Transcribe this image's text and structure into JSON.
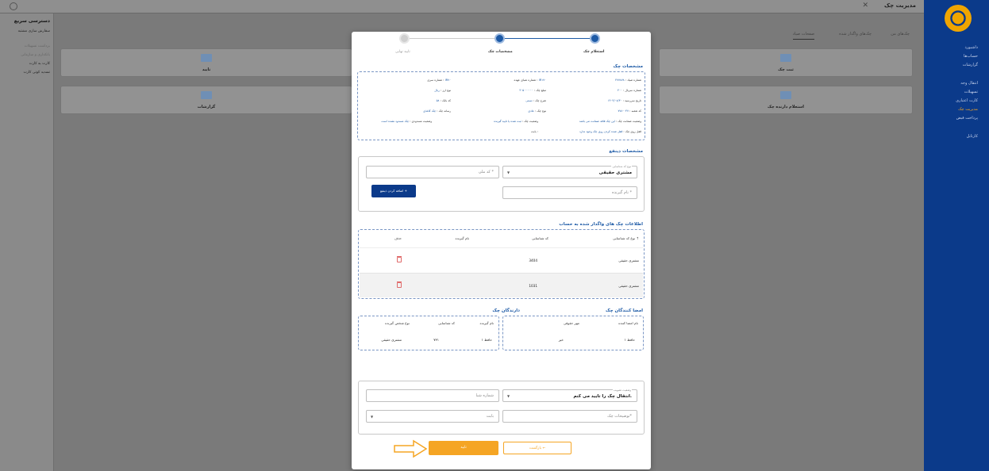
{
  "app": {
    "title": "مدیریت چک"
  },
  "nav": {
    "group1": [
      "داشبورد",
      "حساب‌ها",
      "گزارشات"
    ],
    "group2": [
      "انتقال وجه",
      "تسهیلات",
      "کارت اعتباری",
      "مدیریت چک",
      "پرداخت قبض"
    ],
    "group3": [
      "کارتابل"
    ],
    "active_index": 3
  },
  "quick": {
    "title": "دسترسی سریع",
    "items": [
      "سفارش سازی مشتبه",
      "برداشت تسهیلات",
      "بانکداری و سازمانی",
      "کارت به کارت",
      "تسدید کوتی کارت"
    ]
  },
  "tabs": [
    "چک‌های من",
    "چک‌های واگذار شده",
    "صفحات صیاد"
  ],
  "cards": [
    {
      "label": "ثبت چک"
    },
    {
      "label": "استعلام دارنده چک"
    },
    {
      "label": "تایید"
    },
    {
      "label": "گزارشات"
    }
  ],
  "steps": [
    {
      "label": "استعلام چک"
    },
    {
      "label": "مشخصات چک"
    },
    {
      "label": "تایید نهایی"
    }
  ],
  "check_info": {
    "title": "مشخصات چک",
    "rows": [
      [
        [
          "شماره صیاد :",
          "۴۷۷۸۷۸"
        ],
        [
          "شماره شبای عهده :",
          "IR۱۷۰"
        ],
        [
          "شماره سری :",
          "IR۷۰"
        ]
      ],
      [
        [
          "شماره سریال :",
          "۴۰۰"
        ],
        [
          "مبلغ چک :",
          "۳۰۵۰۰۰۰۰۰"
        ],
        [
          "نوع ارز :",
          "ریال"
        ]
      ],
      [
        [
          "تاریخ سررسید :",
          "۱۴۰۳/۰۸/۳۰"
        ],
        [
          "شرح چک :",
          "تستی"
        ],
        [
          "کد بانک :",
          "۵۸"
        ]
      ],
      [
        [
          "کد شعبه :",
          "۷۷۸۰۰۴۷"
        ],
        [
          "نوع چک :",
          "عادی"
        ],
        [
          "رسانه چک :",
          "چک کاغذی"
        ]
      ],
      [
        [
          "وضعیت ضمانت چک :",
          "این چک فاقد ضمانت می باشد"
        ],
        [
          "وضعیت چک :",
          "ثبت شده یا تایید گیرنده"
        ],
        [
          "وضعیت مسدودی :",
          "چک مسدود نشده است"
        ]
      ],
      [
        [
          "قفل روی چک :",
          "قفل شده کردن روی چک وجود ندارد"
        ],
        [
          "بابت :",
          ""
        ]
      ]
    ]
  },
  "beneficiary": {
    "title": "مشخصات ذینفع",
    "id_type_label": "نوع کد شناسایی",
    "id_type_value": "مشتری حقیقی",
    "national_code_placeholder": "کد ملی *",
    "receiver_name_placeholder": "نام گیرنده *",
    "add_button": "اضافه کردن ذینفع +"
  },
  "transferred": {
    "title": "اطلاعات چک های واگذار شده به حساب",
    "headers": [
      "نوع کد شناسایی ↑",
      "کد شناسایی",
      "نام گیرنده",
      "حذف"
    ],
    "rows": [
      {
        "type": "مشتری حقیقی",
        "code": "3404"
      },
      {
        "type": "مشتری حقیقی",
        "code": "1031"
      }
    ]
  },
  "signers": {
    "title": "امضا کنندگان چک",
    "headers": [
      "نام امضا کننده",
      "مهر حقوقی"
    ],
    "row": [
      "حافظ ۱",
      "خیر"
    ]
  },
  "holders": {
    "title": "دارندگان چک",
    "headers": [
      "نام گیرنده",
      "کد شناسایی",
      "نوع شخص گیرنده"
    ],
    "row": [
      "حافظ ۱",
      "۷۳۱",
      "مشتری حقیقی"
    ]
  },
  "final": {
    "status_label": "وضعیت تصویب",
    "status_value": "انتقال چک را تایید می کنم.",
    "sheba_placeholder": "شماره شبا",
    "desc_placeholder": "توضیحات چک*",
    "for_placeholder": "بابت"
  },
  "buttons": {
    "confirm": "تایید",
    "back": "بازگشت ←"
  }
}
